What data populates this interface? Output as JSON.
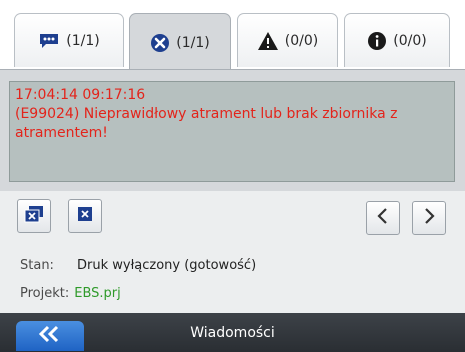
{
  "tabs": [
    {
      "label": "(1/1)",
      "icon": "message-icon"
    },
    {
      "label": "(1/1)",
      "icon": "error-icon"
    },
    {
      "label": "(0/0)",
      "icon": "warning-icon"
    },
    {
      "label": "(0/0)",
      "icon": "info-icon"
    }
  ],
  "message": {
    "timestamp": "17:04:14 09:17:16",
    "text": "(E99024) Nieprawidłowy atrament lub brak zbiornika z atramentem!"
  },
  "status": {
    "state_label": "Stan:",
    "state_value": "Druk wyłączony (gotowość)",
    "project_label": "Projekt:",
    "project_value": "EBS.prj"
  },
  "footer": {
    "title": "Wiadomości"
  },
  "colors": {
    "error_text": "#e3241b",
    "project_value": "#2f9a2a",
    "accent": "#1f63c4"
  }
}
